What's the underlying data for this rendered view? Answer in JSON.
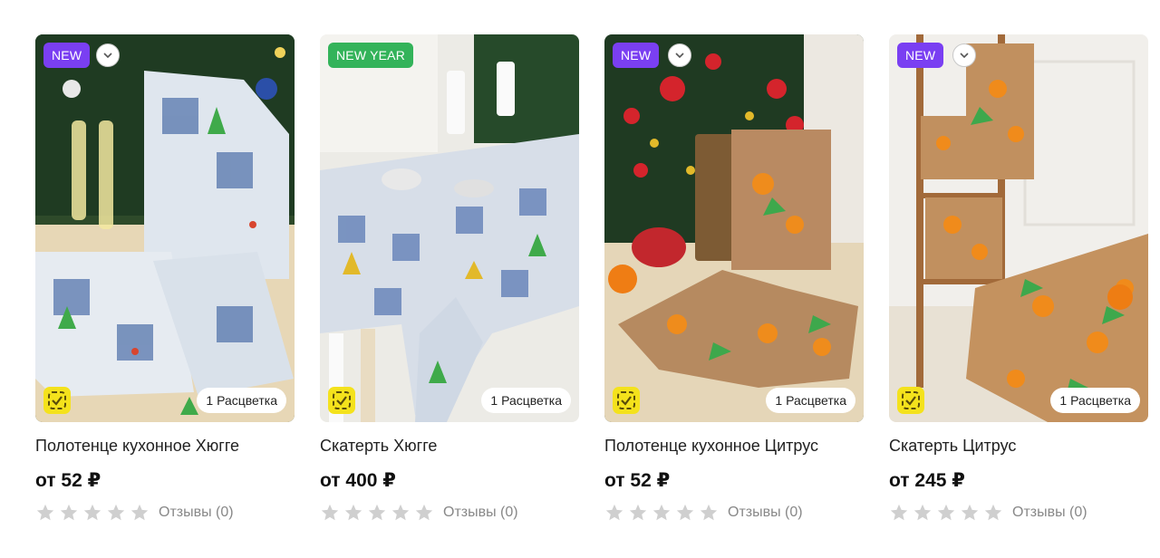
{
  "products": [
    {
      "badge": "NEW",
      "badge_color": "#7a3ff2",
      "title": "Полотенце кухонное Хюгге",
      "price": "от 52 ₽",
      "colors_label": "1 Расцветка",
      "rating": 0,
      "reviews": "Отзывы (0)"
    },
    {
      "badge": "NEW YEAR",
      "badge_color": "#33b35a",
      "title": "Скатерть Хюгге",
      "price": "от 400 ₽",
      "colors_label": "1 Расцветка",
      "rating": 0,
      "reviews": "Отзывы (0)"
    },
    {
      "badge": "NEW",
      "badge_color": "#7a3ff2",
      "title": "Полотенце кухонное Цитрус",
      "price": "от 52 ₽",
      "colors_label": "1 Расцветка",
      "rating": 0,
      "reviews": "Отзывы (0)"
    },
    {
      "badge": "NEW",
      "badge_color": "#7a3ff2",
      "title": "Скатерть Цитрус",
      "price": "от 245 ₽",
      "colors_label": "1 Расцветка",
      "rating": 0,
      "reviews": "Отзывы (0)"
    }
  ],
  "icons": {
    "chevron": "chevron-down-icon",
    "verified": "verified-check-icon",
    "star": "star-icon"
  },
  "colors": {
    "star_empty": "#cfcfcf",
    "verified_bg": "#f4e21c"
  }
}
